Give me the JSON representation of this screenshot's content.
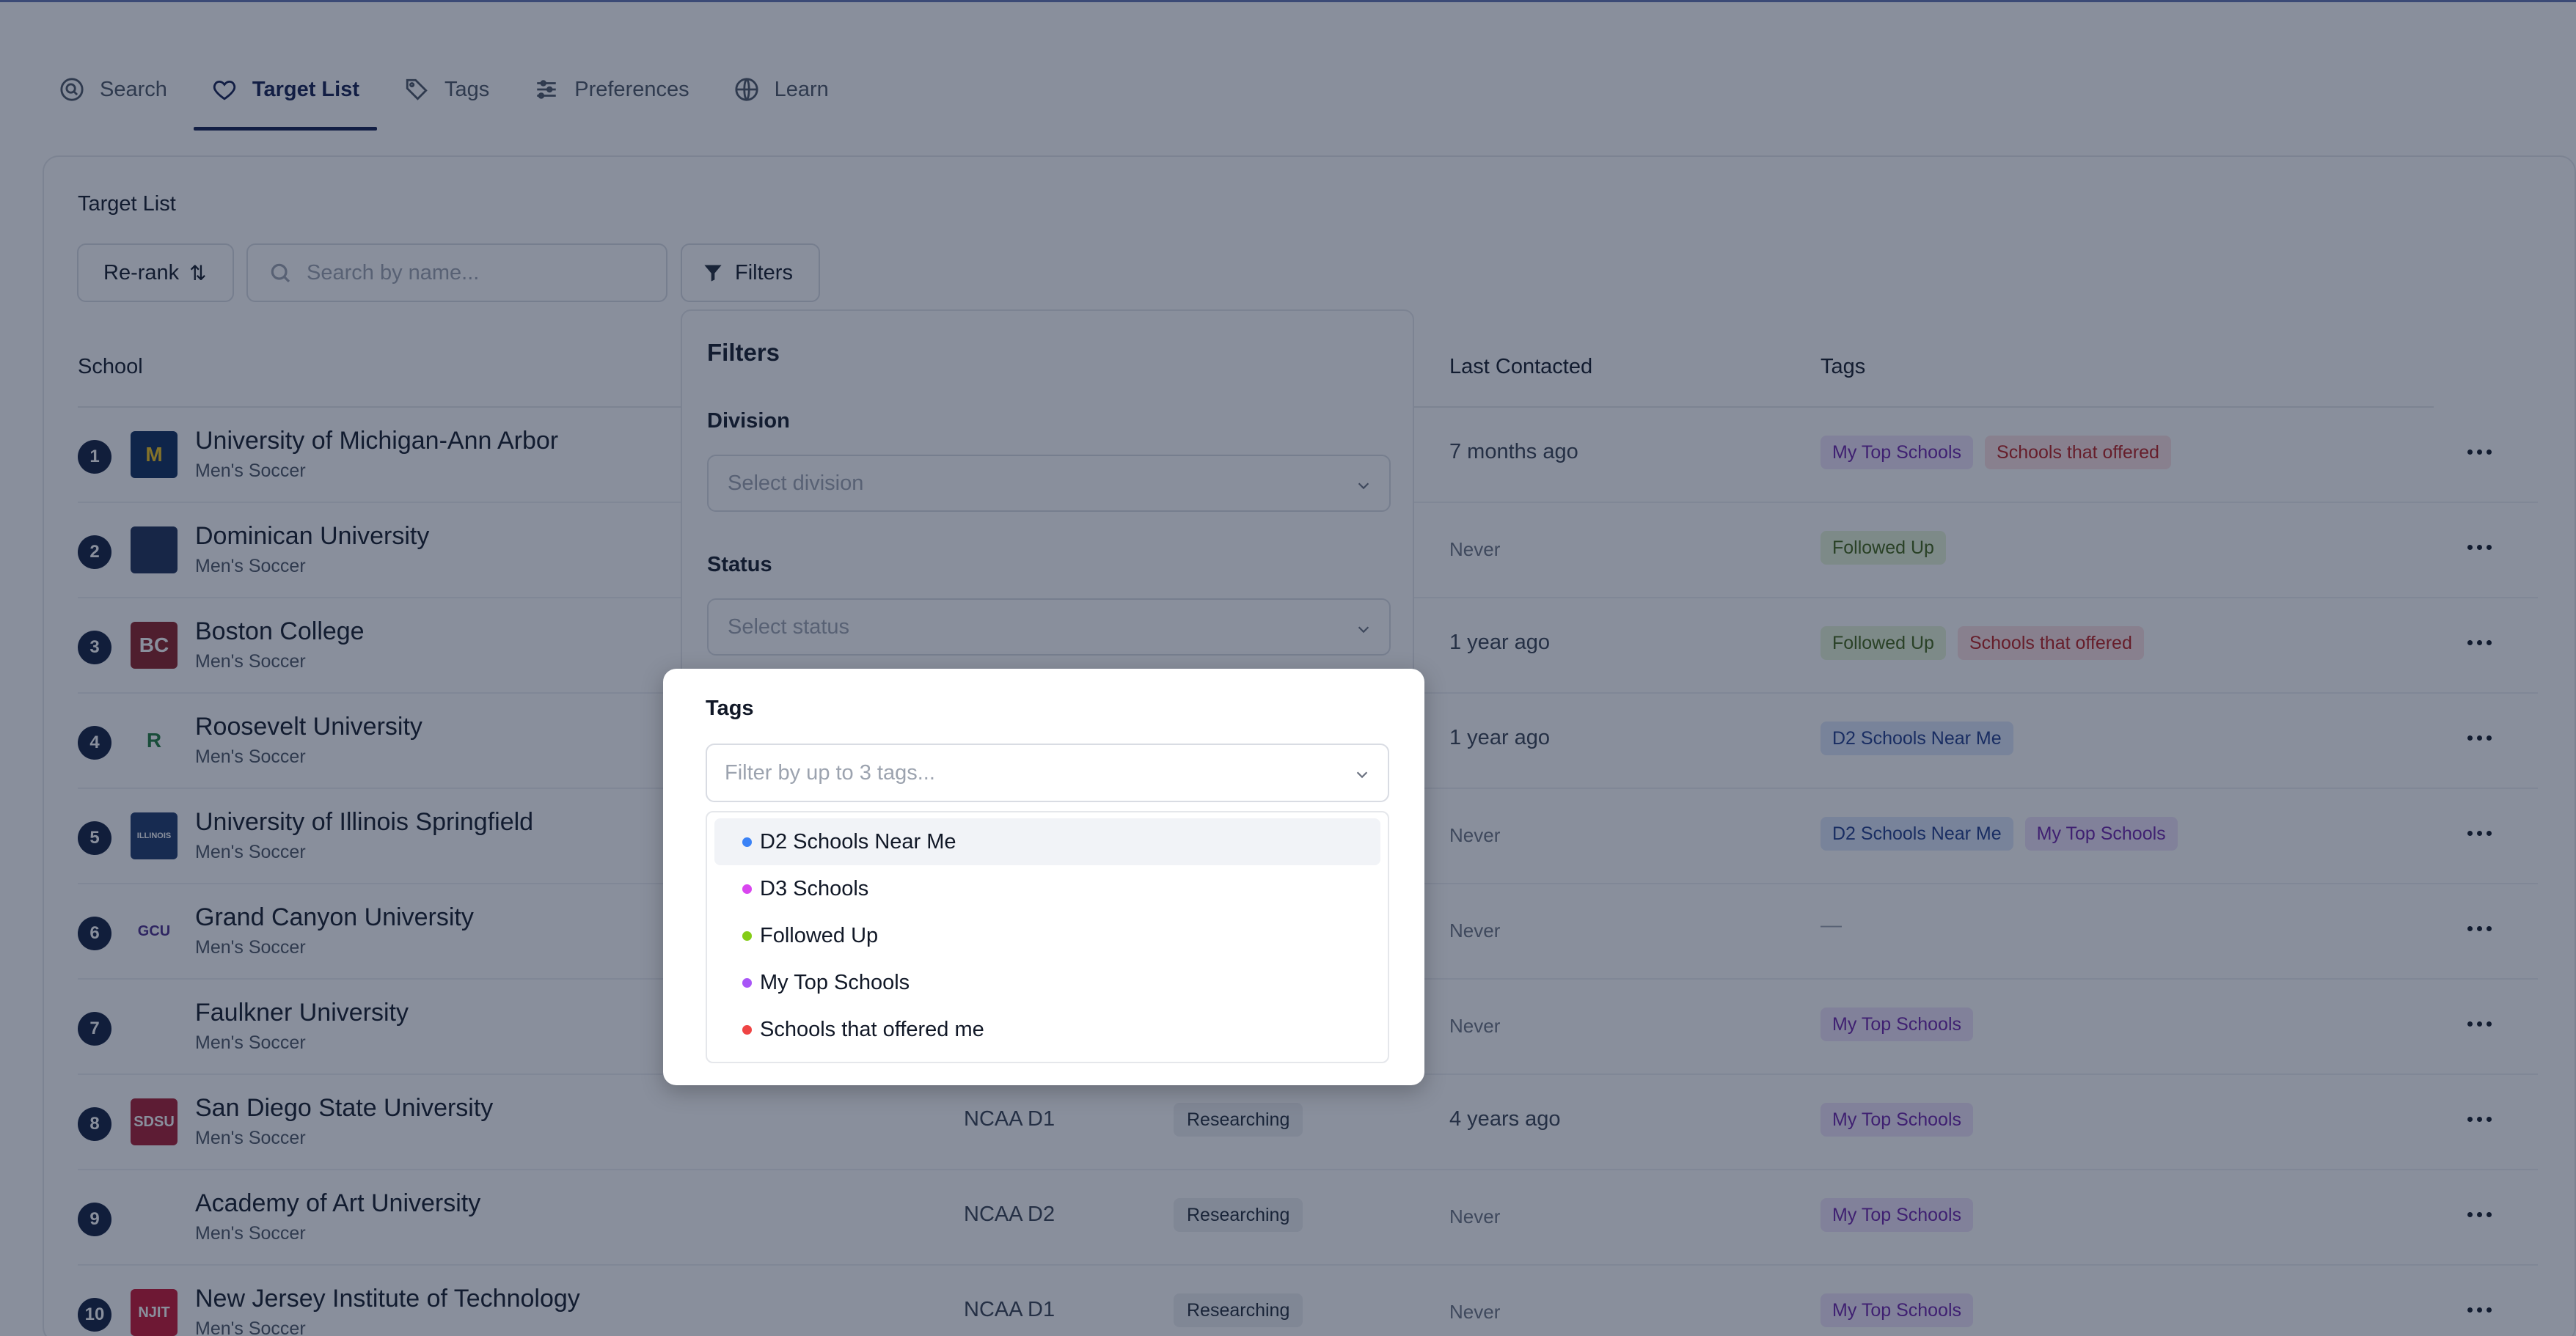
{
  "nav": {
    "items": [
      {
        "label": "Search",
        "icon": "search-circle-icon",
        "active": false
      },
      {
        "label": "Target List",
        "icon": "heart-icon",
        "active": true
      },
      {
        "label": "Tags",
        "icon": "tag-icon",
        "active": false
      },
      {
        "label": "Preferences",
        "icon": "sliders-icon",
        "active": false
      },
      {
        "label": "Learn",
        "icon": "globe-icon",
        "active": false
      }
    ]
  },
  "page": {
    "title": "Target List",
    "rerank_label": "Re-rank",
    "search_placeholder": "Search by name...",
    "filters_label": "Filters"
  },
  "table": {
    "headers": {
      "school": "School",
      "last_contacted": "Last Contacted",
      "tags": "Tags"
    },
    "rows": [
      {
        "rank": "1",
        "name": "University of Michigan-Ann Arbor",
        "sport": "Men's Soccer",
        "division": "",
        "status": "",
        "last": "7 months ago",
        "tags": [
          "My Top Schools",
          "Schools that offered"
        ],
        "logo_text": "M",
        "logo_bg": "#0b2a5b",
        "logo_fg": "#f5c518"
      },
      {
        "rank": "2",
        "name": "Dominican University",
        "sport": "Men's Soccer",
        "division": "",
        "status": "",
        "last": "Never",
        "tags": [
          "Followed Up"
        ],
        "logo_text": "",
        "logo_bg": "#1b2d55",
        "logo_fg": "#ffffff"
      },
      {
        "rank": "3",
        "name": "Boston College",
        "sport": "Men's Soccer",
        "division": "",
        "status": "",
        "last": "1 year ago",
        "tags": [
          "Followed Up",
          "Schools that offered"
        ],
        "logo_text": "BC",
        "logo_bg": "#8a1c22",
        "logo_fg": "#ffffff"
      },
      {
        "rank": "4",
        "name": "Roosevelt University",
        "sport": "Men's Soccer",
        "division": "",
        "status": "",
        "last": "1 year ago",
        "tags": [
          "D2 Schools Near Me"
        ],
        "logo_text": "R",
        "logo_bg": "#ffffff",
        "logo_fg": "#1f7a3a"
      },
      {
        "rank": "5",
        "name": "University of Illinois Springfield",
        "sport": "Men's Soccer",
        "division": "",
        "status": "",
        "last": "Never",
        "tags": [
          "D2 Schools Near Me",
          "My Top Schools"
        ],
        "logo_text": "ILLINOIS",
        "logo_bg": "#1a3668",
        "logo_fg": "#ffffff"
      },
      {
        "rank": "6",
        "name": "Grand Canyon University",
        "sport": "Men's Soccer",
        "division": "",
        "status": "",
        "last": "Never",
        "tags": [],
        "logo_text": "GCU",
        "logo_bg": "#ffffff",
        "logo_fg": "#4b2c8a"
      },
      {
        "rank": "7",
        "name": "Faulkner University",
        "sport": "Men's Soccer",
        "division": "",
        "status": "",
        "last": "Never",
        "tags": [
          "My Top Schools"
        ],
        "logo_text": "",
        "logo_bg": "#ffffff",
        "logo_fg": "#1b3a6b"
      },
      {
        "rank": "8",
        "name": "San Diego State University",
        "sport": "Men's Soccer",
        "division": "NCAA D1",
        "status": "Researching",
        "last": "4 years ago",
        "tags": [
          "My Top Schools"
        ],
        "logo_text": "SDSU",
        "logo_bg": "#a6192e",
        "logo_fg": "#ffffff"
      },
      {
        "rank": "9",
        "name": "Academy of Art University",
        "sport": "Men's Soccer",
        "division": "NCAA D2",
        "status": "Researching",
        "last": "Never",
        "tags": [
          "My Top Schools"
        ],
        "logo_text": "",
        "logo_bg": "#ffffff",
        "logo_fg": "#333333"
      },
      {
        "rank": "10",
        "name": "New Jersey Institute of Technology",
        "sport": "Men's Soccer",
        "division": "NCAA D1",
        "status": "Researching",
        "last": "Never",
        "tags": [
          "My Top Schools"
        ],
        "logo_text": "NJIT",
        "logo_bg": "#c8102e",
        "logo_fg": "#ffffff"
      }
    ],
    "empty_tag_placeholder": "—"
  },
  "filters_panel": {
    "title": "Filters",
    "division_label": "Division",
    "division_placeholder": "Select division",
    "status_label": "Status",
    "status_placeholder": "Select status"
  },
  "tags_modal": {
    "label": "Tags",
    "placeholder": "Filter by up to 3 tags...",
    "options": [
      {
        "label": "D2 Schools Near Me",
        "color": "#3b82f6",
        "highlighted": true
      },
      {
        "label": "D3 Schools",
        "color": "#d946ef",
        "highlighted": false
      },
      {
        "label": "Followed Up",
        "color": "#84cc16",
        "highlighted": false
      },
      {
        "label": "My Top Schools",
        "color": "#a855f7",
        "highlighted": false
      },
      {
        "label": "Schools that offered me",
        "color": "#ef4444",
        "highlighted": false
      }
    ]
  },
  "colors": {
    "accent": "#111c4e",
    "overlay": "#14203a"
  }
}
